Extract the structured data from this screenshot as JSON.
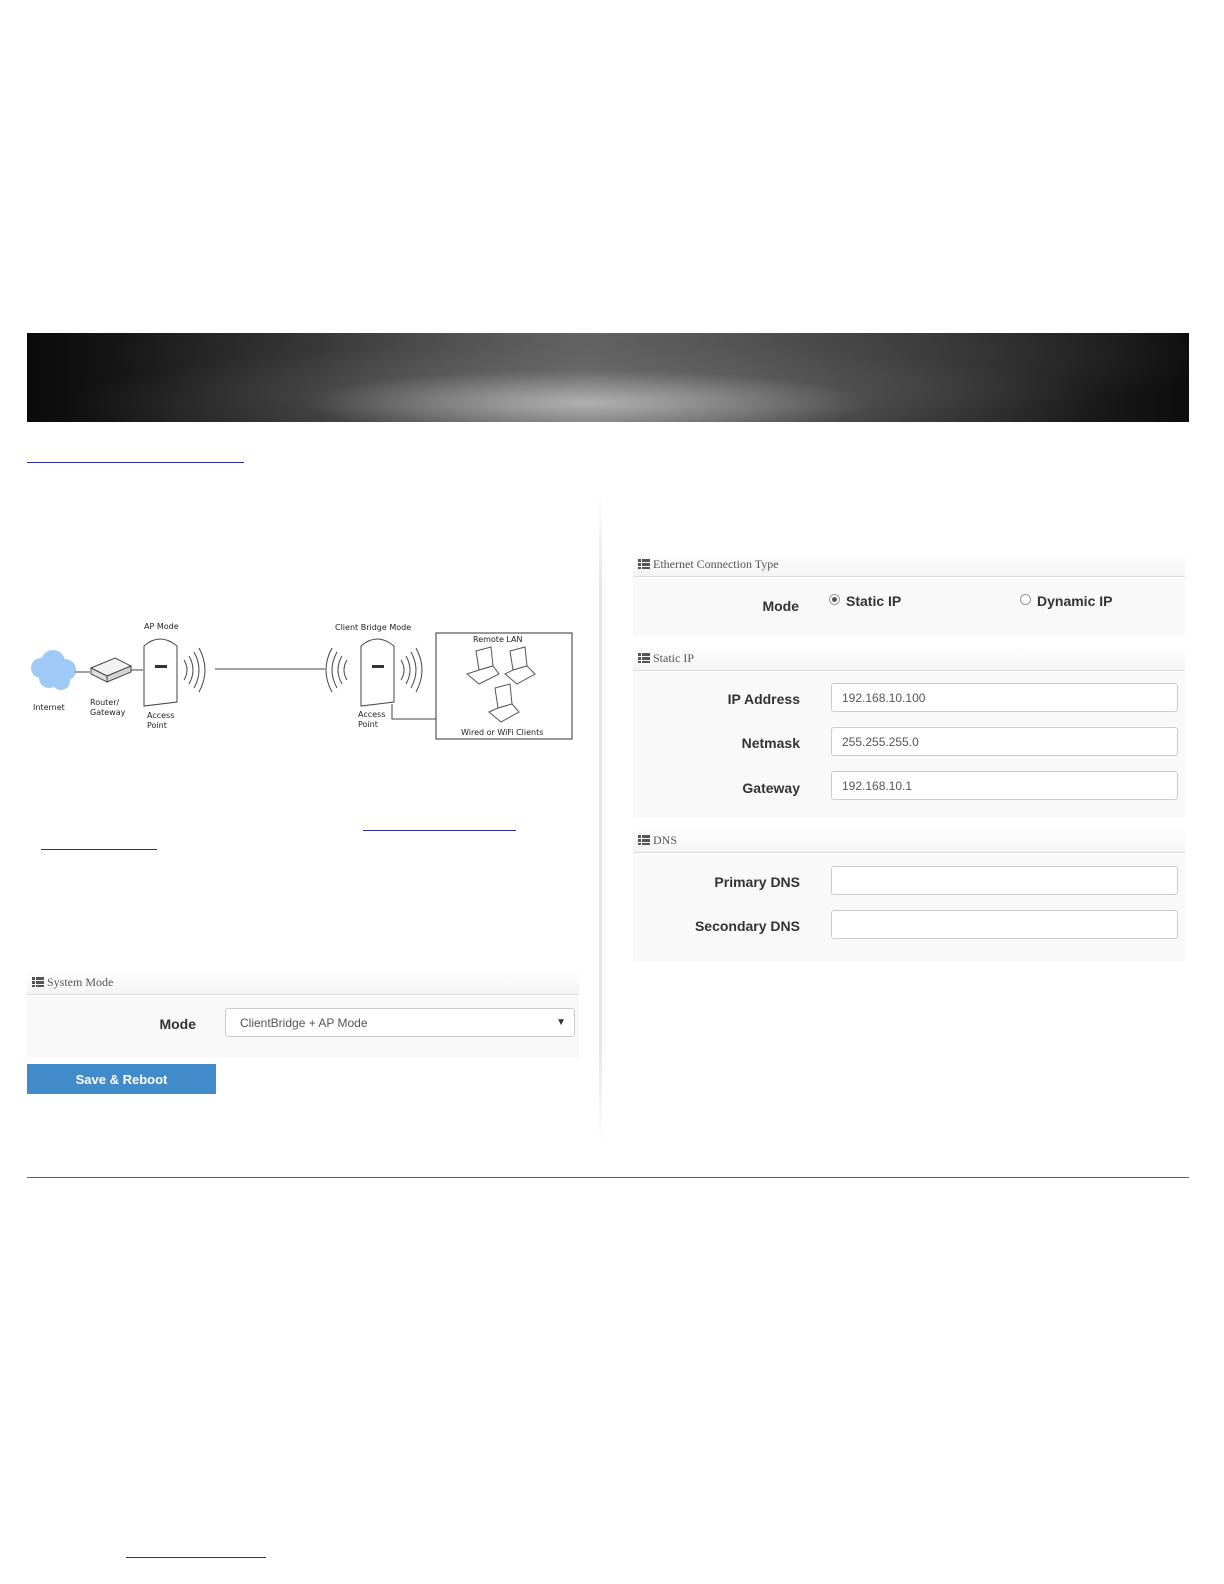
{
  "system_mode_panel": {
    "title": "System Mode",
    "mode_label": "Mode",
    "mode_value": "ClientBridge + AP Mode",
    "save_label": "Save & Reboot"
  },
  "diagram": {
    "ap_mode": "AP Mode",
    "client_bridge_mode": "Client Bridge Mode",
    "internet": "Internet",
    "router_1": "Router/",
    "router_2": "Gateway",
    "access_1": "Access",
    "point_1": "Point",
    "access_2": "Access",
    "point_2": "Point",
    "remote_lan": "Remote LAN",
    "clients": "Wired or WiFi Clients"
  },
  "ethernet_panel": {
    "title": "Ethernet Connection Type",
    "mode_label": "Mode",
    "option_static": "Static IP",
    "option_dynamic": "Dynamic IP",
    "selected": "Static IP"
  },
  "static_ip_panel": {
    "title": "Static IP",
    "ip_label": "IP Address",
    "ip_value": "192.168.10.100",
    "netmask_label": "Netmask",
    "netmask_value": "255.255.255.0",
    "gateway_label": "Gateway",
    "gateway_value": "192.168.10.1"
  },
  "dns_panel": {
    "title": "DNS",
    "primary_label": "Primary DNS",
    "primary_value": "",
    "secondary_label": "Secondary DNS",
    "secondary_value": ""
  }
}
